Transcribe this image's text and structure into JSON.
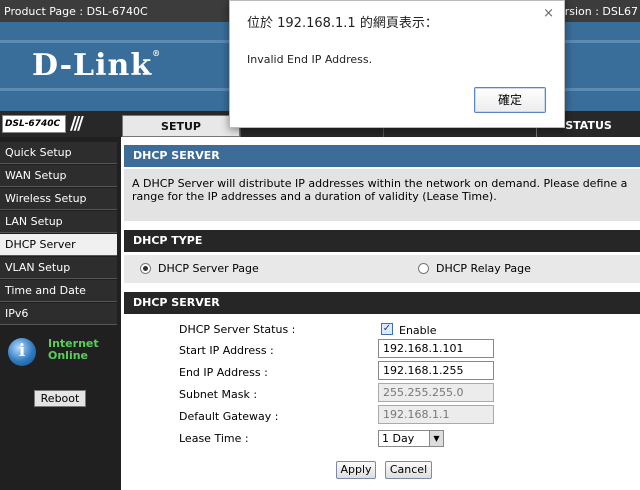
{
  "header": {
    "product_label": "Product Page : DSL-6740C",
    "version_label": "ersion : DSL67",
    "logo_text": "D-Link",
    "logo_mark": "®"
  },
  "model_box": "DSL-6740C",
  "tabs": {
    "setup": "SETUP",
    "status": "STATUS"
  },
  "sidebar": {
    "items": [
      {
        "label": "Quick Setup"
      },
      {
        "label": "WAN Setup"
      },
      {
        "label": "Wireless Setup"
      },
      {
        "label": "LAN Setup"
      },
      {
        "label": "DHCP Server",
        "active": true
      },
      {
        "label": "VLAN Setup"
      },
      {
        "label": "Time and Date"
      },
      {
        "label": "IPv6"
      }
    ],
    "status_line1": "Internet",
    "status_line2": "Online",
    "reboot_label": "Reboot"
  },
  "main": {
    "section_title": "DHCP SERVER",
    "description": "A DHCP Server will distribute IP addresses within the network on demand. Please define a range for the IP addresses and a duration of validity (Lease Time).",
    "dhcp_type_title": "DHCP TYPE",
    "radio_server": "DHCP Server Page",
    "radio_relay": "DHCP Relay Page",
    "radio_selected": "server",
    "form_title": "DHCP SERVER",
    "fields": {
      "status_label": "DHCP Server Status :",
      "enable_label": "Enable",
      "enable_checked": true,
      "start_label": "Start IP Address :",
      "start_value": "192.168.1.101",
      "end_label": "End IP Address :",
      "end_value": "192.168.1.255",
      "mask_label": "Subnet Mask :",
      "mask_value": "255.255.255.0",
      "gateway_label": "Default Gateway :",
      "gateway_value": "192.168.1.1",
      "lease_label": "Lease Time :",
      "lease_value": "1 Day"
    },
    "apply_label": "Apply",
    "cancel_label": "Cancel"
  },
  "dialog": {
    "title": "位於 192.168.1.1 的網頁表示：",
    "message": "Invalid End IP Address.",
    "ok_label": "確定",
    "close_glyph": "×"
  },
  "colors": {
    "banner": "#3a6e9a",
    "section_blue": "#3e6c98",
    "section_dark": "#262626",
    "status_green": "#58d058"
  }
}
